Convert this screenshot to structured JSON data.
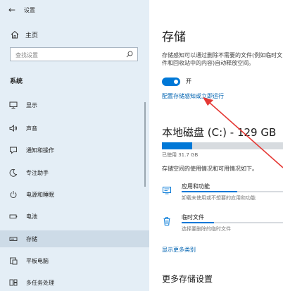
{
  "sidebar": {
    "title": "设置",
    "home_label": "主页",
    "search_placeholder": "查找设置",
    "section_title": "系统",
    "items": [
      {
        "label": "显示"
      },
      {
        "label": "声音"
      },
      {
        "label": "通知和操作"
      },
      {
        "label": "专注助手"
      },
      {
        "label": "电源和睡眠"
      },
      {
        "label": "电池"
      },
      {
        "label": "存储"
      },
      {
        "label": "平板电脑"
      },
      {
        "label": "多任务处理"
      }
    ],
    "selected_index": 6
  },
  "main": {
    "title": "存储",
    "description": "存储感知可以通过删除不需要的文件(例如临时文件和回收站中的内容)自动释放空间。",
    "toggle_label": "开",
    "toggle_on": true,
    "configure_link": "配置存储感知或立即运行",
    "drive_title": "本地磁盘 (C:) - 129 GB",
    "used_text": "已使用 31.7 GB",
    "used_fraction": 0.25,
    "usage_description": "存储空间的使用情况和可用情况如下。",
    "categories": [
      {
        "name": "应用和功能",
        "sub": "卸载未使用或不想要的应用和功能",
        "icon": "apps-icon",
        "fill_fraction": 0.55
      },
      {
        "name": "临时文件",
        "sub": "选择要删除的临时文件",
        "icon": "trash-icon",
        "fill_fraction": 0.32
      }
    ],
    "more_link": "显示更多类别",
    "more_settings_title": "更多存储设置"
  },
  "colors": {
    "accent": "#0078d7",
    "sidebar_bg": "#e4eef6",
    "annotation_arrow": "#e53935"
  }
}
